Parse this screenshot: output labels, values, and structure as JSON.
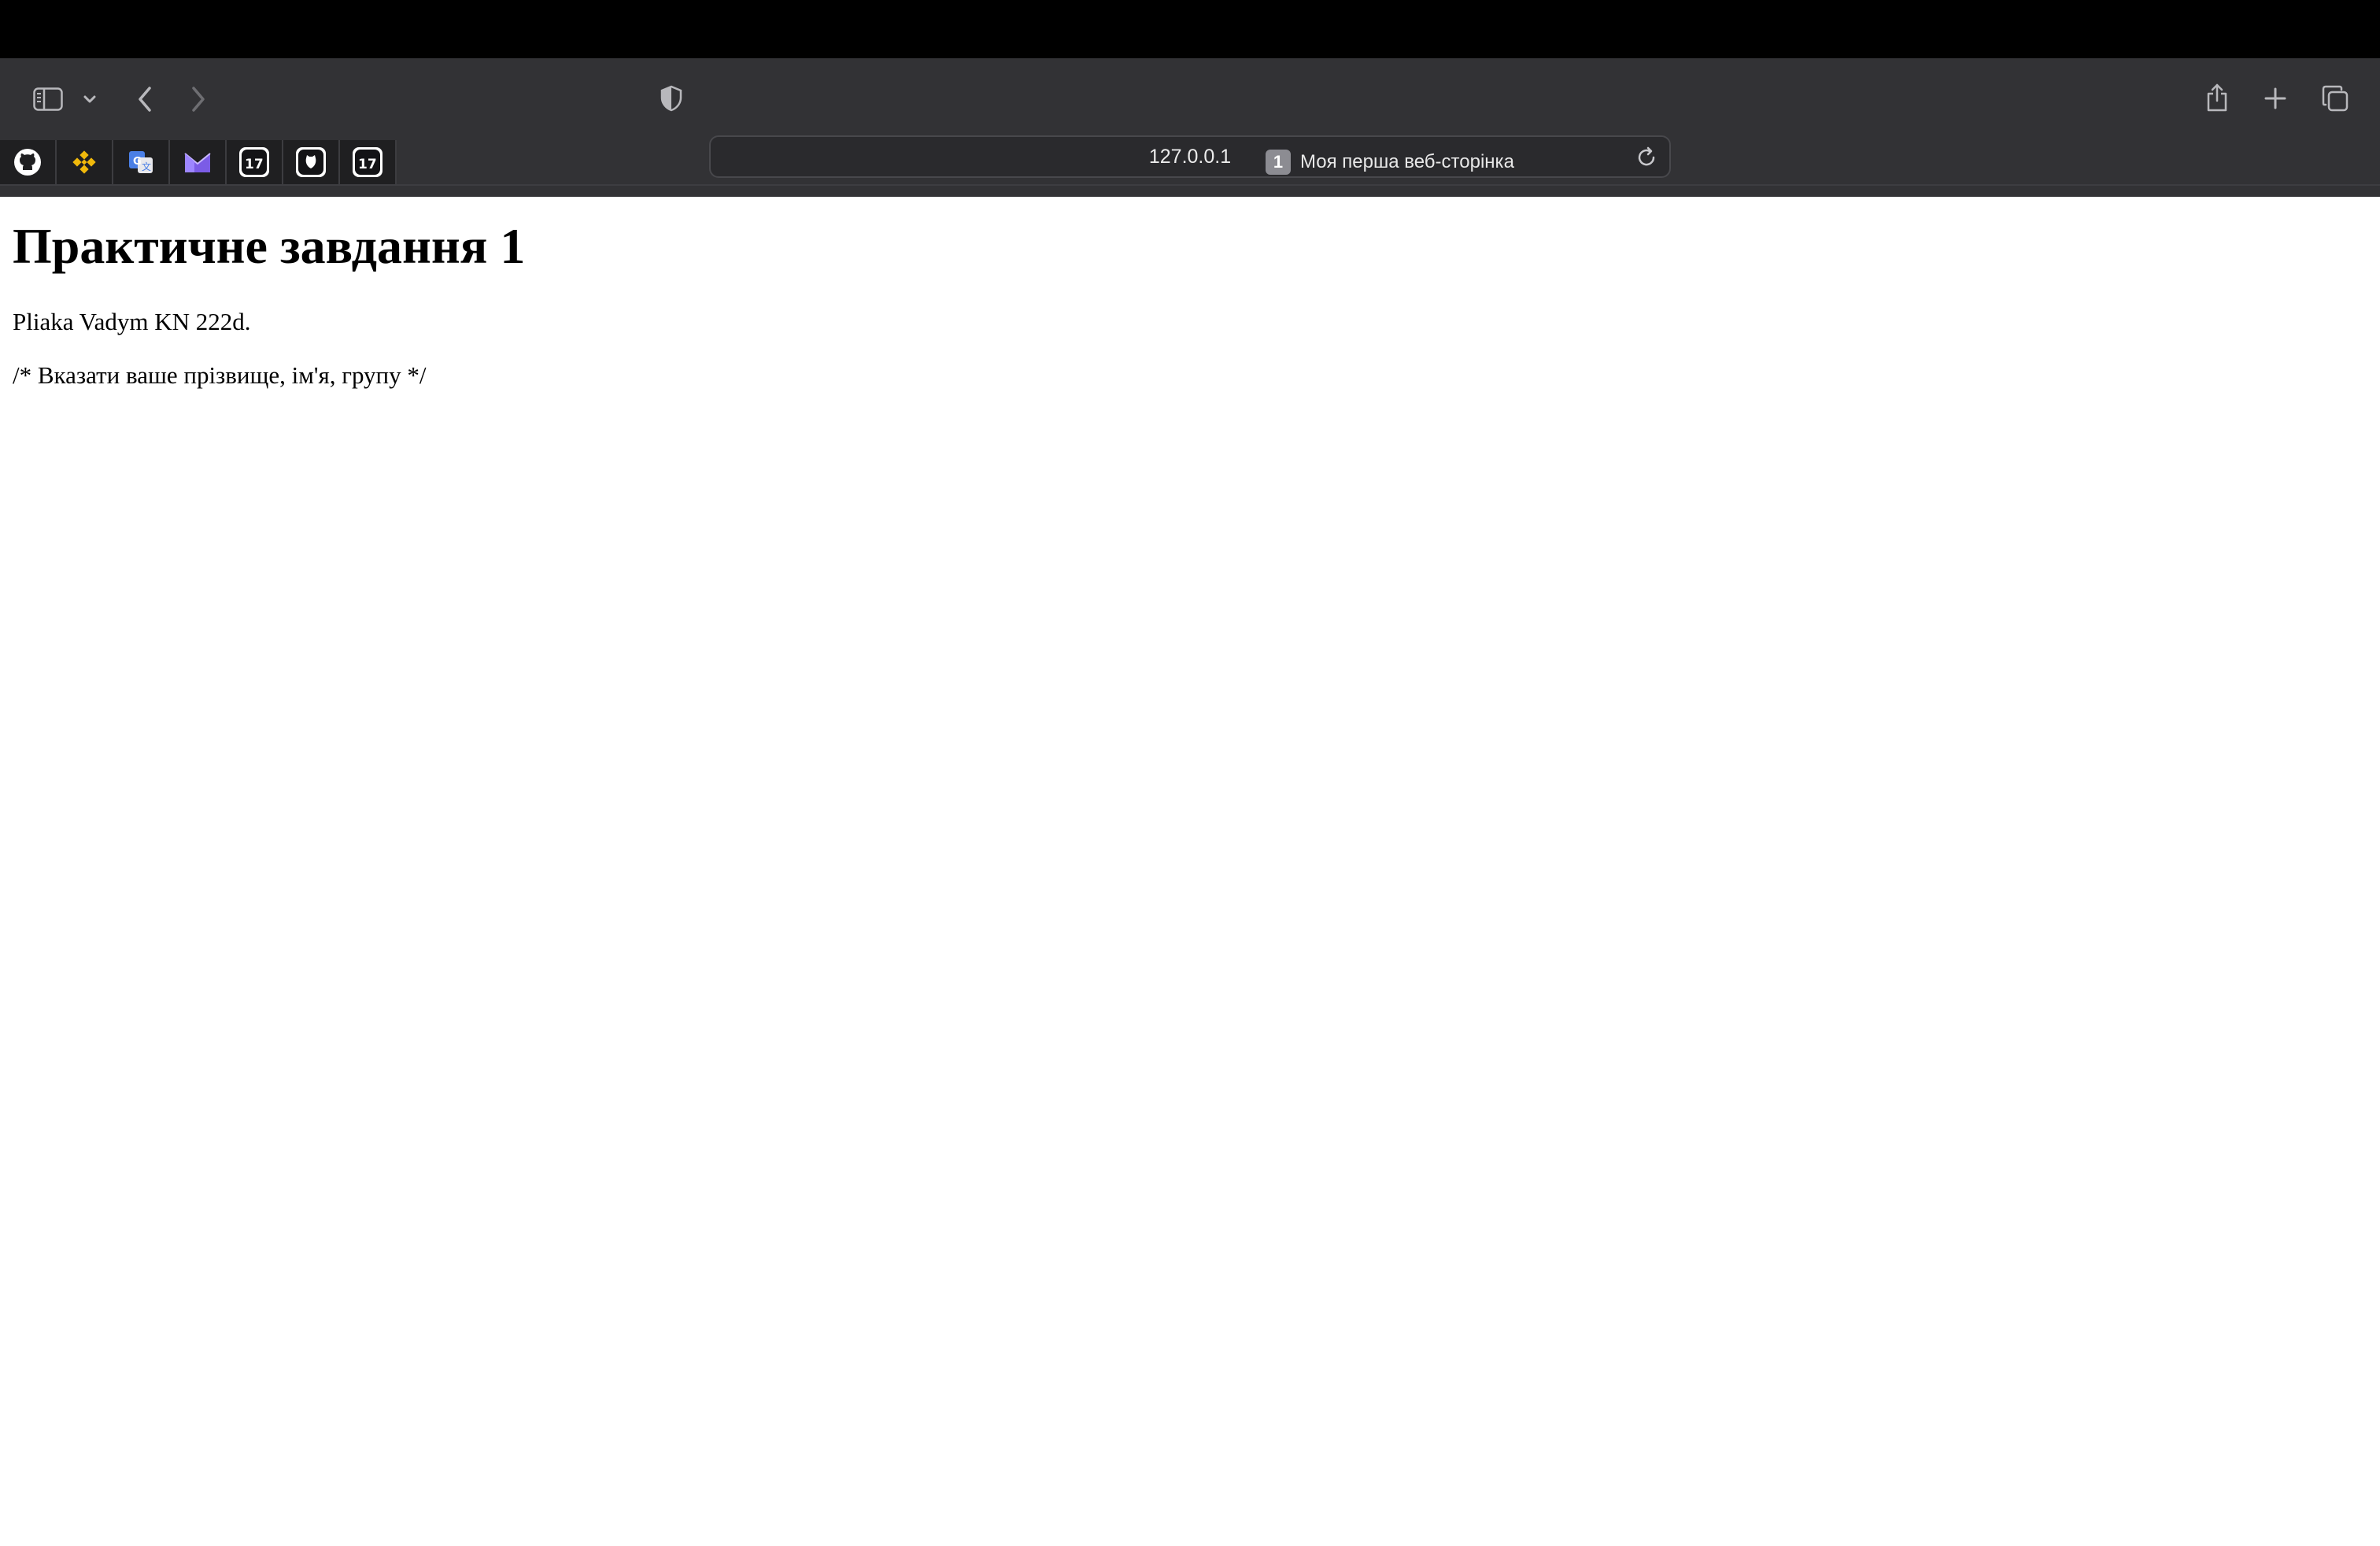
{
  "browser": {
    "url": "127.0.0.1",
    "tab": {
      "count": "1",
      "title": "Моя перша веб-сторінка"
    },
    "toolbar_icons": [
      "sidebar-icon",
      "chevron-down-icon",
      "back-arrow-icon",
      "forward-arrow-icon",
      "privacy-shield-icon",
      "reload-icon",
      "share-icon",
      "new-tab-plus-icon",
      "tab-overview-icon"
    ],
    "favorites": [
      "github-icon",
      "binance-icon",
      "google-translate-icon",
      "proton-mail-icon",
      "tradingview-icon",
      "bear-icon",
      "tradingview-icon"
    ]
  },
  "page": {
    "heading": "Практичне завдання 1",
    "author_line": "Pliaka Vadym KN 222d.",
    "comment_line": "/* Вказати ваше прізвище, ім'я, групу */"
  },
  "colors": {
    "menubar": "#000000",
    "toolbar": "#323235",
    "urlbar": "#2a2a2d",
    "page_background": "#ffffff",
    "binance_yellow": "#f0b90b",
    "google_blue": "#4a7fe6",
    "proton_purple": "#7b5ce6"
  }
}
